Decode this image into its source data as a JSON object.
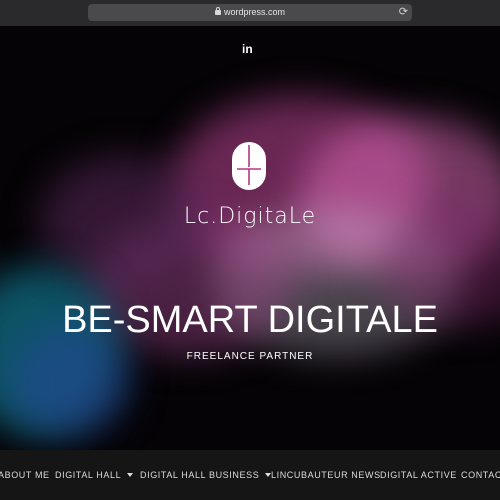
{
  "browser": {
    "url": "wordpress.com"
  },
  "hero": {
    "logo_text": "Lc.DigitaLe",
    "headline": "BE-SMART DIGITALE",
    "tagline": "FREELANCE PARTNER",
    "social_icon": "linkedin-icon",
    "social_label": "in"
  },
  "nav": {
    "items": [
      {
        "label": "ABOUT ME",
        "dropdown": false
      },
      {
        "label": "DIGITAL HALL",
        "dropdown": true
      },
      {
        "label": "DIGITAL HALL BUSINESS",
        "dropdown": true
      },
      {
        "label": "LINCUBAUTEUR NEWS",
        "dropdown": false
      },
      {
        "label": "DIGITAL ACTIVE",
        "dropdown": false
      },
      {
        "label": "CONTACT",
        "dropdown": false
      }
    ]
  },
  "colors": {
    "nav_background": "#151515",
    "browser_chrome": "#2a2a2c",
    "accent_pink": "#d84fa0",
    "accent_cyan": "#1aa6c2"
  }
}
